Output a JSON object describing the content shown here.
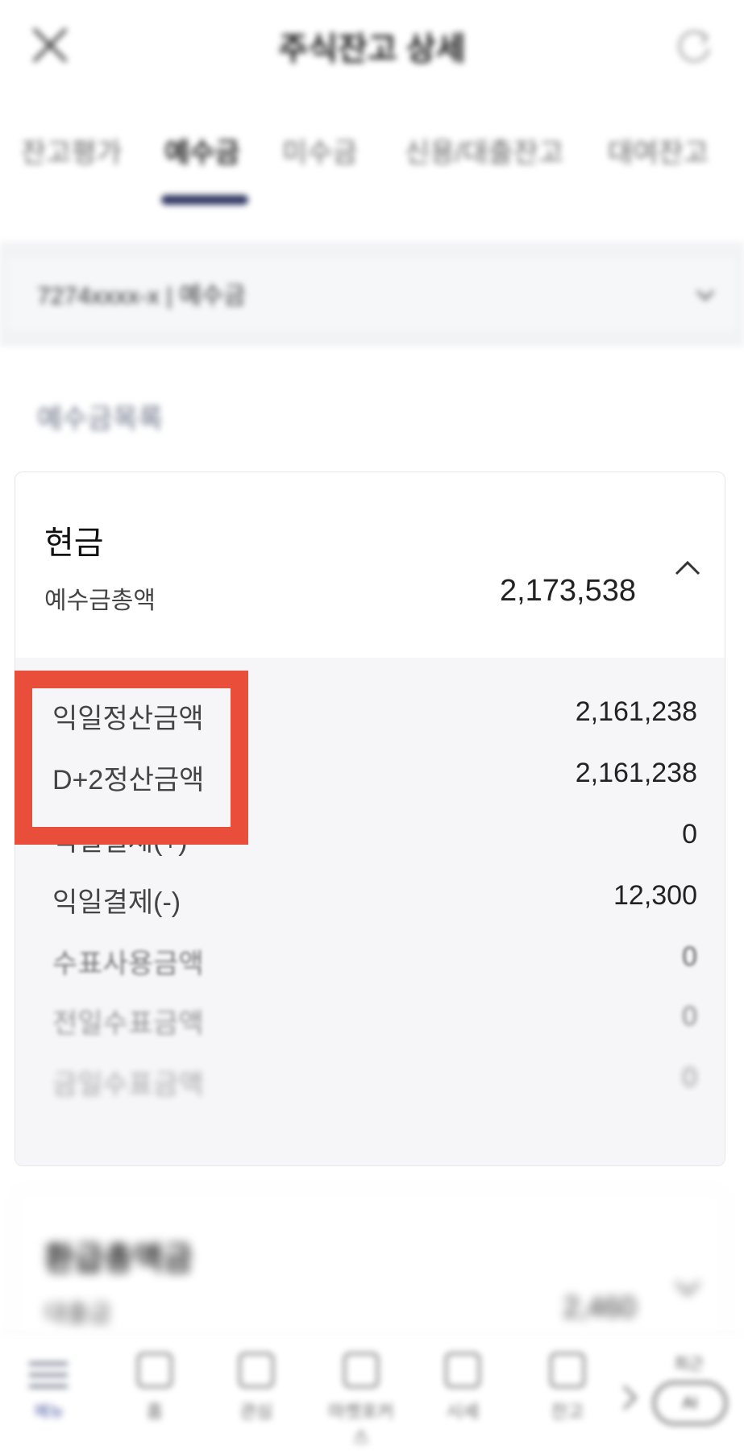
{
  "header": {
    "title": "주식잔고 상세",
    "close_icon": "close-icon",
    "refresh_icon": "refresh-icon"
  },
  "tabs": [
    {
      "label": "잔고평가",
      "active": false
    },
    {
      "label": "예수금",
      "active": true
    },
    {
      "label": "미수금",
      "active": false
    },
    {
      "label": "신용/대출잔고",
      "active": false
    },
    {
      "label": "대여잔고",
      "active": false
    }
  ],
  "account": {
    "label": "7274xxxx-x | 예수금"
  },
  "section_title": "예수금목록",
  "cash_card": {
    "title": "현금",
    "total_label": "예수금총액",
    "total_value": "2,173,538",
    "rows": [
      {
        "label": "익일정산금액",
        "value": "2,161,238"
      },
      {
        "label": "D+2정산금액",
        "value": "2,161,238"
      },
      {
        "label": "익일결제(+)",
        "value": "0"
      },
      {
        "label": "익일결제(-)",
        "value": "12,300"
      },
      {
        "label": "수표사용금액",
        "value": "0"
      },
      {
        "label": "전일수표금액",
        "value": "0"
      },
      {
        "label": "금일수표금액",
        "value": "0"
      }
    ]
  },
  "second_card": {
    "title": "환급총액금",
    "sub_label": "대출금",
    "value": "2,460"
  },
  "bottom_nav": {
    "menu_label": "메뉴",
    "items": [
      {
        "label": "홈",
        "icon": "home-icon"
      },
      {
        "label": "관심",
        "icon": "star-icon"
      },
      {
        "label": "마켓포커스",
        "icon": "market-icon"
      },
      {
        "label": "시세",
        "icon": "chart-icon"
      },
      {
        "label": "잔고",
        "icon": "wallet-icon"
      }
    ],
    "fab_top_label": "최근",
    "fab_label": "AI"
  },
  "colors": {
    "highlight": "#e84e3a",
    "tab_indicator": "#2d3561",
    "section_title": "#6b7487"
  }
}
